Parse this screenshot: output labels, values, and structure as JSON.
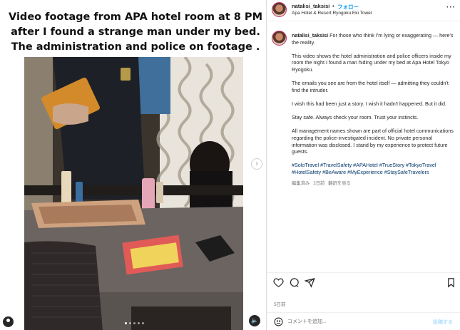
{
  "media": {
    "title": "Video footage from APA hotel room at 8 PM after I found a strange man under my bed. The administration and police on footage .",
    "slide_count": 5,
    "active_slide": 1
  },
  "post": {
    "username": "natalisi_taksisi",
    "separator": "•",
    "follow_label": "フォロー",
    "location": "Apa Hotel & Resort Ryogoku Eki Tower",
    "more_icon": "more-horizontal-icon"
  },
  "caption": {
    "username": "natalisi_taksisi",
    "intro": "For those who think I'm lying or exaggerating — here's the reality.",
    "paragraphs": [
      "This video shows the hotel administration and police officers inside my room the night I found a man hiding under my bed at Apa Hotel Tokyo Ryogoku.",
      "The emails you see are from the hotel itself — admitting they couldn't find the intruder.",
      "I wish this had been just a story. I wish it hadn't happened. But it did.",
      "Stay safe. Always check your room. Trust your instincts.",
      "All management names shown are part of official hotel communications regarding the police-investigated incident. No private personal information was disclosed. I stand by my experience to protect future guests."
    ],
    "hashtags": "#SoloTravel #TravelSafety #APAHotel #TrueStory #TokyoTravel #HotelSafety #BeAware #MyExperience #StaySafeTravelers",
    "edited_label": "編集済み",
    "age": "2日前",
    "translate_label": "翻訳を見る"
  },
  "actions": {
    "icons": [
      "heart-icon",
      "comment-icon",
      "share-icon",
      "bookmark-icon"
    ]
  },
  "date_label": "5日前",
  "comment": {
    "placeholder": "コメントを追加...",
    "post_label": "投稿する"
  },
  "colors": {
    "link_blue": "#0095f6",
    "hashtag": "#00376b",
    "muted": "#737373",
    "post_disabled": "#b2dffc"
  }
}
